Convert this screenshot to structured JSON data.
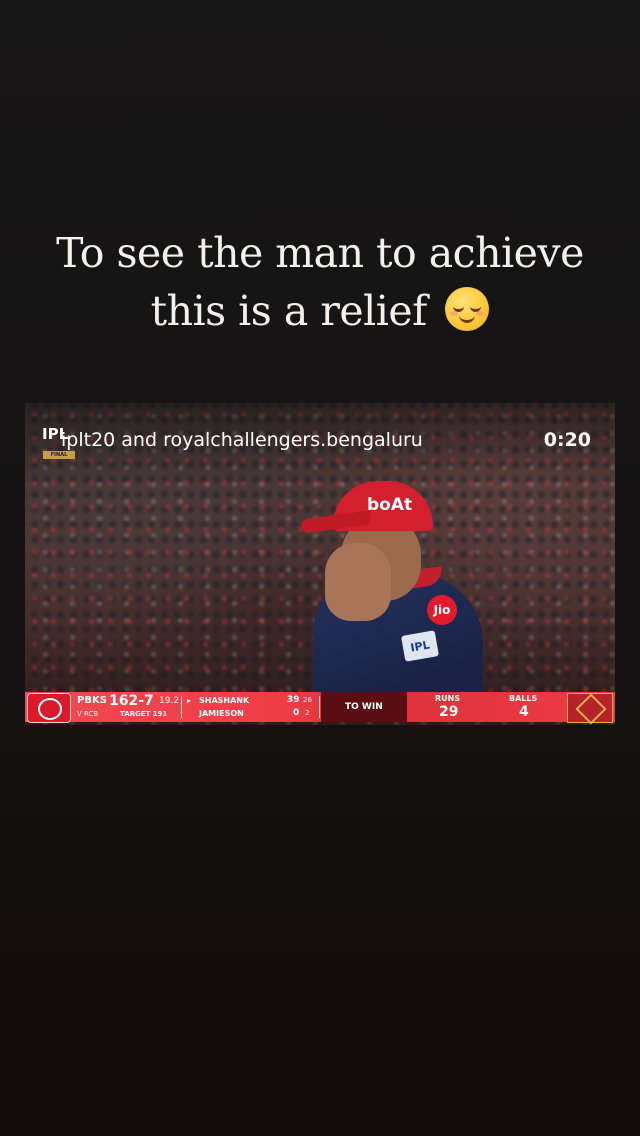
{
  "story": {
    "caption_line1": "To see the man to achieve",
    "caption_line2": "this is a relief",
    "emoji_icon": "relieved-face-icon"
  },
  "reel": {
    "source_text": "iplt20 and royalchallengers.bengaluru",
    "source_logo_text": "IPL",
    "source_logo_badge": "FINAL",
    "timer": "0:20",
    "cap_logo": "boAt",
    "jersey_sponsor": "Jio",
    "jersey_badge": "IPL"
  },
  "scorebar": {
    "team": "PBKS",
    "score": "162-7",
    "overs": "19.2",
    "vs": "V RCB",
    "target": "TARGET 191",
    "batter1_name": "SHASHANK",
    "batter1_runs": "39",
    "batter1_balls": "26",
    "batter2_name": "JAMIESON",
    "batter2_runs": "0",
    "batter2_balls": "2",
    "to_win_label": "TO WIN",
    "runs_label": "RUNS",
    "runs_value": "29",
    "balls_label": "BALLS",
    "balls_value": "4",
    "colors": {
      "bar": "#ef3c45",
      "mid": "#5a0e13"
    }
  }
}
